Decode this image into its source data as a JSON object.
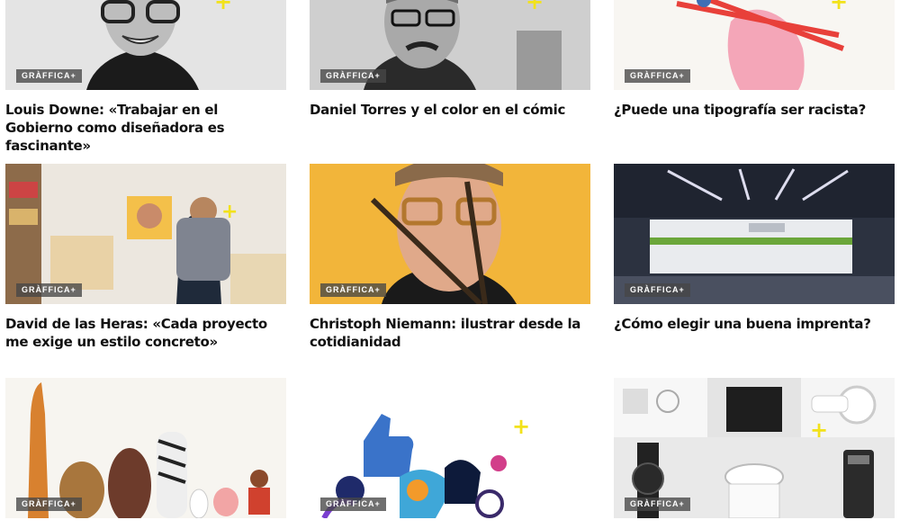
{
  "badge_label": "GRÀFFICA+",
  "accent_yellow": "#f2e21b",
  "cards": [
    {
      "title": "Louis Downe: «Trabajar en el Gobierno como diseñadora es fascinante»",
      "image": "portrait of smiling woman with glasses (black and white)"
    },
    {
      "title": "Daniel Torres y el color en el cómic",
      "image": "portrait of man with glasses and moustache (black and white)"
    },
    {
      "title": "¿Puede una tipografía ser racista?",
      "image": "pink hand holding red chopsticks illustration"
    },
    {
      "title": "David de las Heras: «Cada proyecto me exige un estilo concreto»",
      "image": "illustrator at desk in studio"
    },
    {
      "title": "Christoph Niemann: ilustrar desde la cotidianidad",
      "image": "man with glasses holding pencils on yellow background"
    },
    {
      "title": "¿Cómo elegir una buena imprenta?",
      "image": "industrial printing machine in hall"
    },
    {
      "title": "",
      "image": "illustration of giraffe, gorilla, zebra and other animals"
    },
    {
      "title": "",
      "image": "illustration of thumbs up and people"
    },
    {
      "title": "",
      "image": "grid of Braun product designs"
    }
  ]
}
